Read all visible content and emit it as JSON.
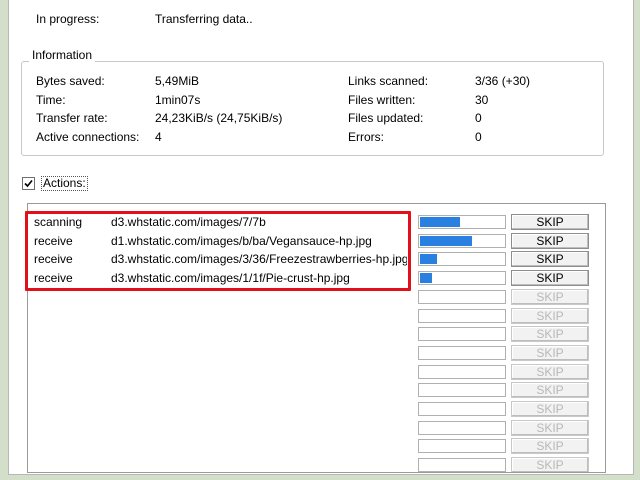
{
  "status": {
    "label": "In progress:",
    "value": "Transferring data.."
  },
  "information": {
    "legend": "Information",
    "left": [
      {
        "label": "Bytes saved:",
        "value": "5,49MiB"
      },
      {
        "label": "Time:",
        "value": "1min07s"
      },
      {
        "label": "Transfer rate:",
        "value": "24,23KiB/s (24,75KiB/s)"
      },
      {
        "label": "Active connections:",
        "value": "4"
      }
    ],
    "right": [
      {
        "label": "Links scanned:",
        "value": "3/36 (+30)"
      },
      {
        "label": "Files written:",
        "value": "30"
      },
      {
        "label": "Files updated:",
        "value": "0"
      },
      {
        "label": "Errors:",
        "value": "0"
      }
    ]
  },
  "actions": {
    "label": "Actions:",
    "checked": true
  },
  "skip_label": "SKIP",
  "active_rows": [
    {
      "kind": "scanning",
      "url": "d3.whstatic.com/images/7/7b",
      "progress": 0.48
    },
    {
      "kind": "receive",
      "url": "d1.whstatic.com/images/b/ba/Vegansauce-hp.jpg",
      "progress": 0.62
    },
    {
      "kind": "receive",
      "url": "d3.whstatic.com/images/3/36/Freezestrawberries-hp.jpg",
      "progress": 0.2
    },
    {
      "kind": "receive",
      "url": "d3.whstatic.com/images/1/1f/Pie-crust-hp.jpg",
      "progress": 0.14
    }
  ],
  "idle_row_count": 10,
  "colors": {
    "highlight": "#e2101a",
    "progress": "#2a80e0",
    "background": "#d3dfc9"
  }
}
